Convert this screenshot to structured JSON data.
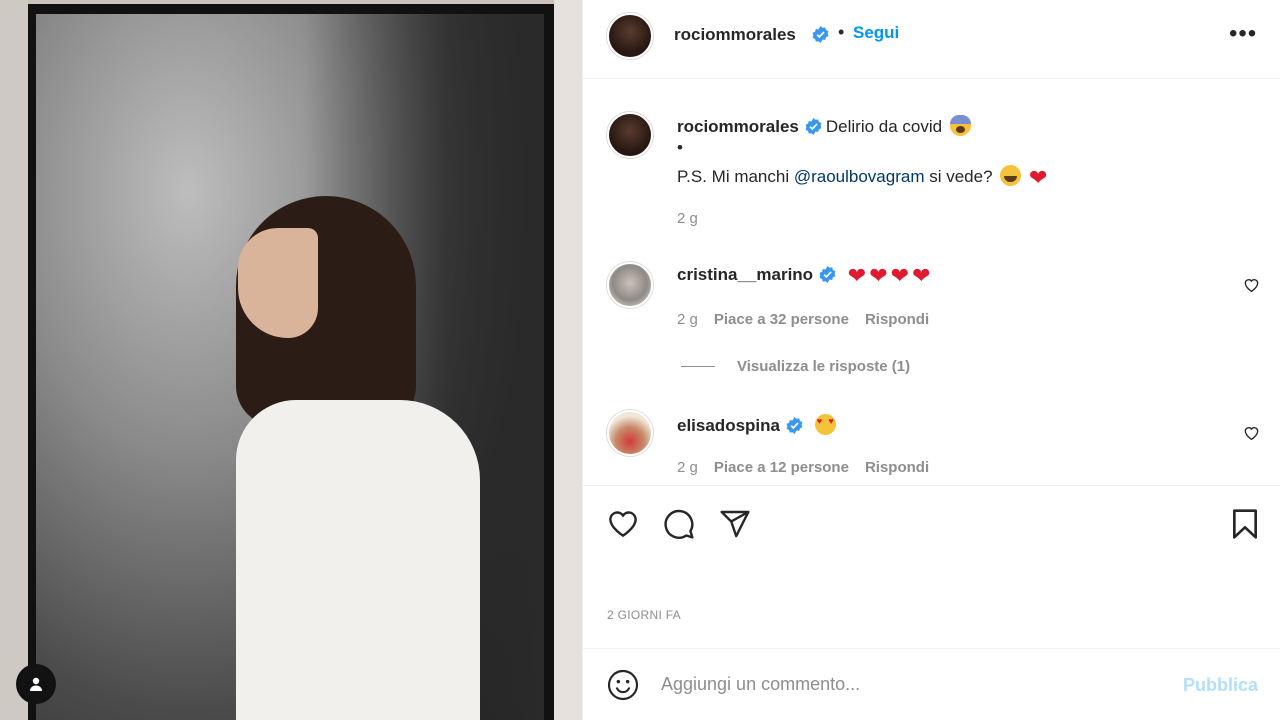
{
  "post": {
    "author": "rociommorales",
    "follow_label": "Segui",
    "separator": "•",
    "more_label": "•••"
  },
  "caption": {
    "username": "rociommorales",
    "text1": "Delirio da covid",
    "bullet": "•",
    "text2_prefix": "P.S. Mi manchi ",
    "mention": "@raoulbovagram",
    "text2_suffix": " si vede?",
    "time": "2 g"
  },
  "comments": [
    {
      "username": "cristina__marino",
      "time": "2 g",
      "likes": "Piace a 32 persone",
      "reply": "Rispondi"
    },
    {
      "username": "elisadospina",
      "time": "2 g",
      "likes": "Piace a 12 persone",
      "reply": "Rispondi"
    }
  ],
  "view_replies": "Visualizza le risposte (1)",
  "date": "2 GIORNI FA",
  "add_comment": {
    "placeholder": "Aggiungi un commento...",
    "publish": "Pubblica"
  },
  "colors": {
    "accent": "#0095f6",
    "verified": "#3897f0",
    "heart": "#e0192e",
    "publish_disabled": "#b2dffc"
  },
  "icons": [
    "user-tag-icon",
    "verified-icon",
    "more-icon",
    "heart-icon",
    "comment-icon",
    "share-icon",
    "bookmark-icon",
    "emoji-icon"
  ]
}
